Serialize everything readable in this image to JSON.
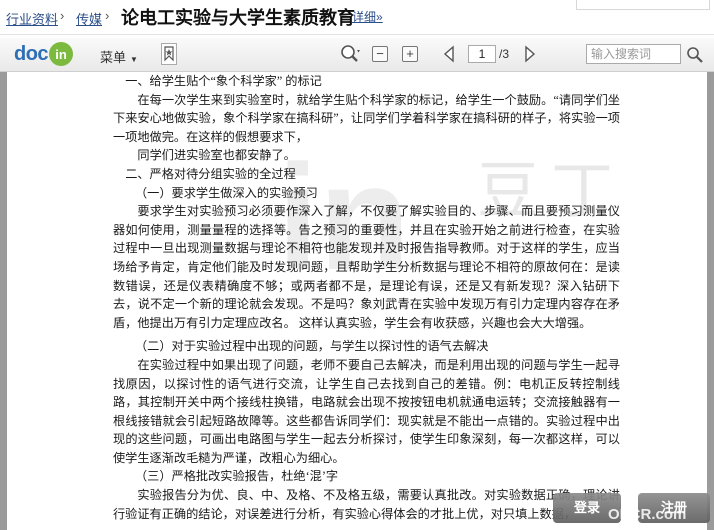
{
  "breadcrumb": {
    "items": [
      "行业资料",
      "传媒"
    ],
    "separator": "›",
    "title": "论电工实验与大学生素质教育",
    "detail_link": "详细»"
  },
  "toolbar": {
    "logo_doc": "doc",
    "logo_in": "in",
    "menu_label": "菜单",
    "current_page": "1",
    "total_pages": "/3",
    "search_placeholder": "输入搜索词",
    "icons": [
      "bookmark-icon",
      "search-zoom-icon",
      "zoom-out-icon",
      "zoom-in-icon",
      "prev-page-icon",
      "next-page-icon",
      "search-submit-icon"
    ]
  },
  "watermark": {
    "logo": "in",
    "text": "豆丁"
  },
  "document": {
    "paragraphs": [
      {
        "style": "h",
        "text": "一、给学生贴个“象个科学家” 的标记"
      },
      {
        "style": "ind",
        "text": "在每一次学生来到实验室时，就给学生贴个科学家的标记，给学生一个鼓励。“请同学们坐下来安心地做实验，象个科学家在搞科研”，让同学们学着科学家在搞科研的样子，将实验一项一项地做完。在这样的假想要求下，"
      },
      {
        "style": "ind",
        "text": "同学们进实验室也都安静了。"
      },
      {
        "style": "h",
        "text": "二、严格对待分组实验的全过程"
      },
      {
        "style": "hh",
        "text": "（一）要求学生做深入的实验预习"
      },
      {
        "style": "ind",
        "text": "要求学生对实验预习必须要作深入了解，不仅要了解实验目的、步骤、而且要预习测量仪器如何使用，测量量程的选择等。告之预习的重要性，并且在实验开始之前进行检查，在实验过程中一旦出现测量数据与理论不相符也能发现并及时报告指导教师。对于这样的学生，应当场给予肯定，肯定他们能及时发现问题，且帮助学生分析数据与理论不相符的原故何在：是读数错误，还是仪表精确度不够；或两者都不是，是理论有误，还是又有新发现？深入钻研下去，说不定一个新的理论就会发现。不是吗？象刘武青在实验中发现万有引力定理内容存在矛盾，他提出万有引力定理应改名。 这样认真实验，学生会有收获感，兴趣也会大大增强。"
      },
      {
        "style": "hh",
        "text": "（二）对于实验过程中出现的问题，与学生以探讨性的语气去解决"
      },
      {
        "style": "ind",
        "text": "在实验过程中如果出现了问题，老师不要自己去解决，而是利用出现的问题与学生一起寻找原因，以探讨性的语气进行交流，让学生自己去找到自己的差错。例：电机正反转控制线路，其控制开关中两个接线柱换错，电路就会出现不按按钮电机就通电运转；交流接触器有一根线接错就会引起短路故障等。这些都告诉同学们：现实就是不能出一点错的。实验过程中出现的这些问题，可画出电路图与学生一起去分析探讨，使学生印象深刻，每一次都这样，可以使学生逐渐改毛糙为严谨，改粗心为细心。"
      },
      {
        "style": "hh",
        "text": "（三）严格批改实验报告，杜绝‘混’字"
      },
      {
        "style": "ind",
        "text": "实验报告分为优、良、中、及格、不及格五级，需要认真批改。对实验数据正确，理论讲行验证有正确的结论，对误差进行分析，有实验心得体会的才批上优，对只填上数据，"
      }
    ]
  },
  "buttons": {
    "login": "登录",
    "register": "注册"
  },
  "corner_watermark": "OECR.com"
}
